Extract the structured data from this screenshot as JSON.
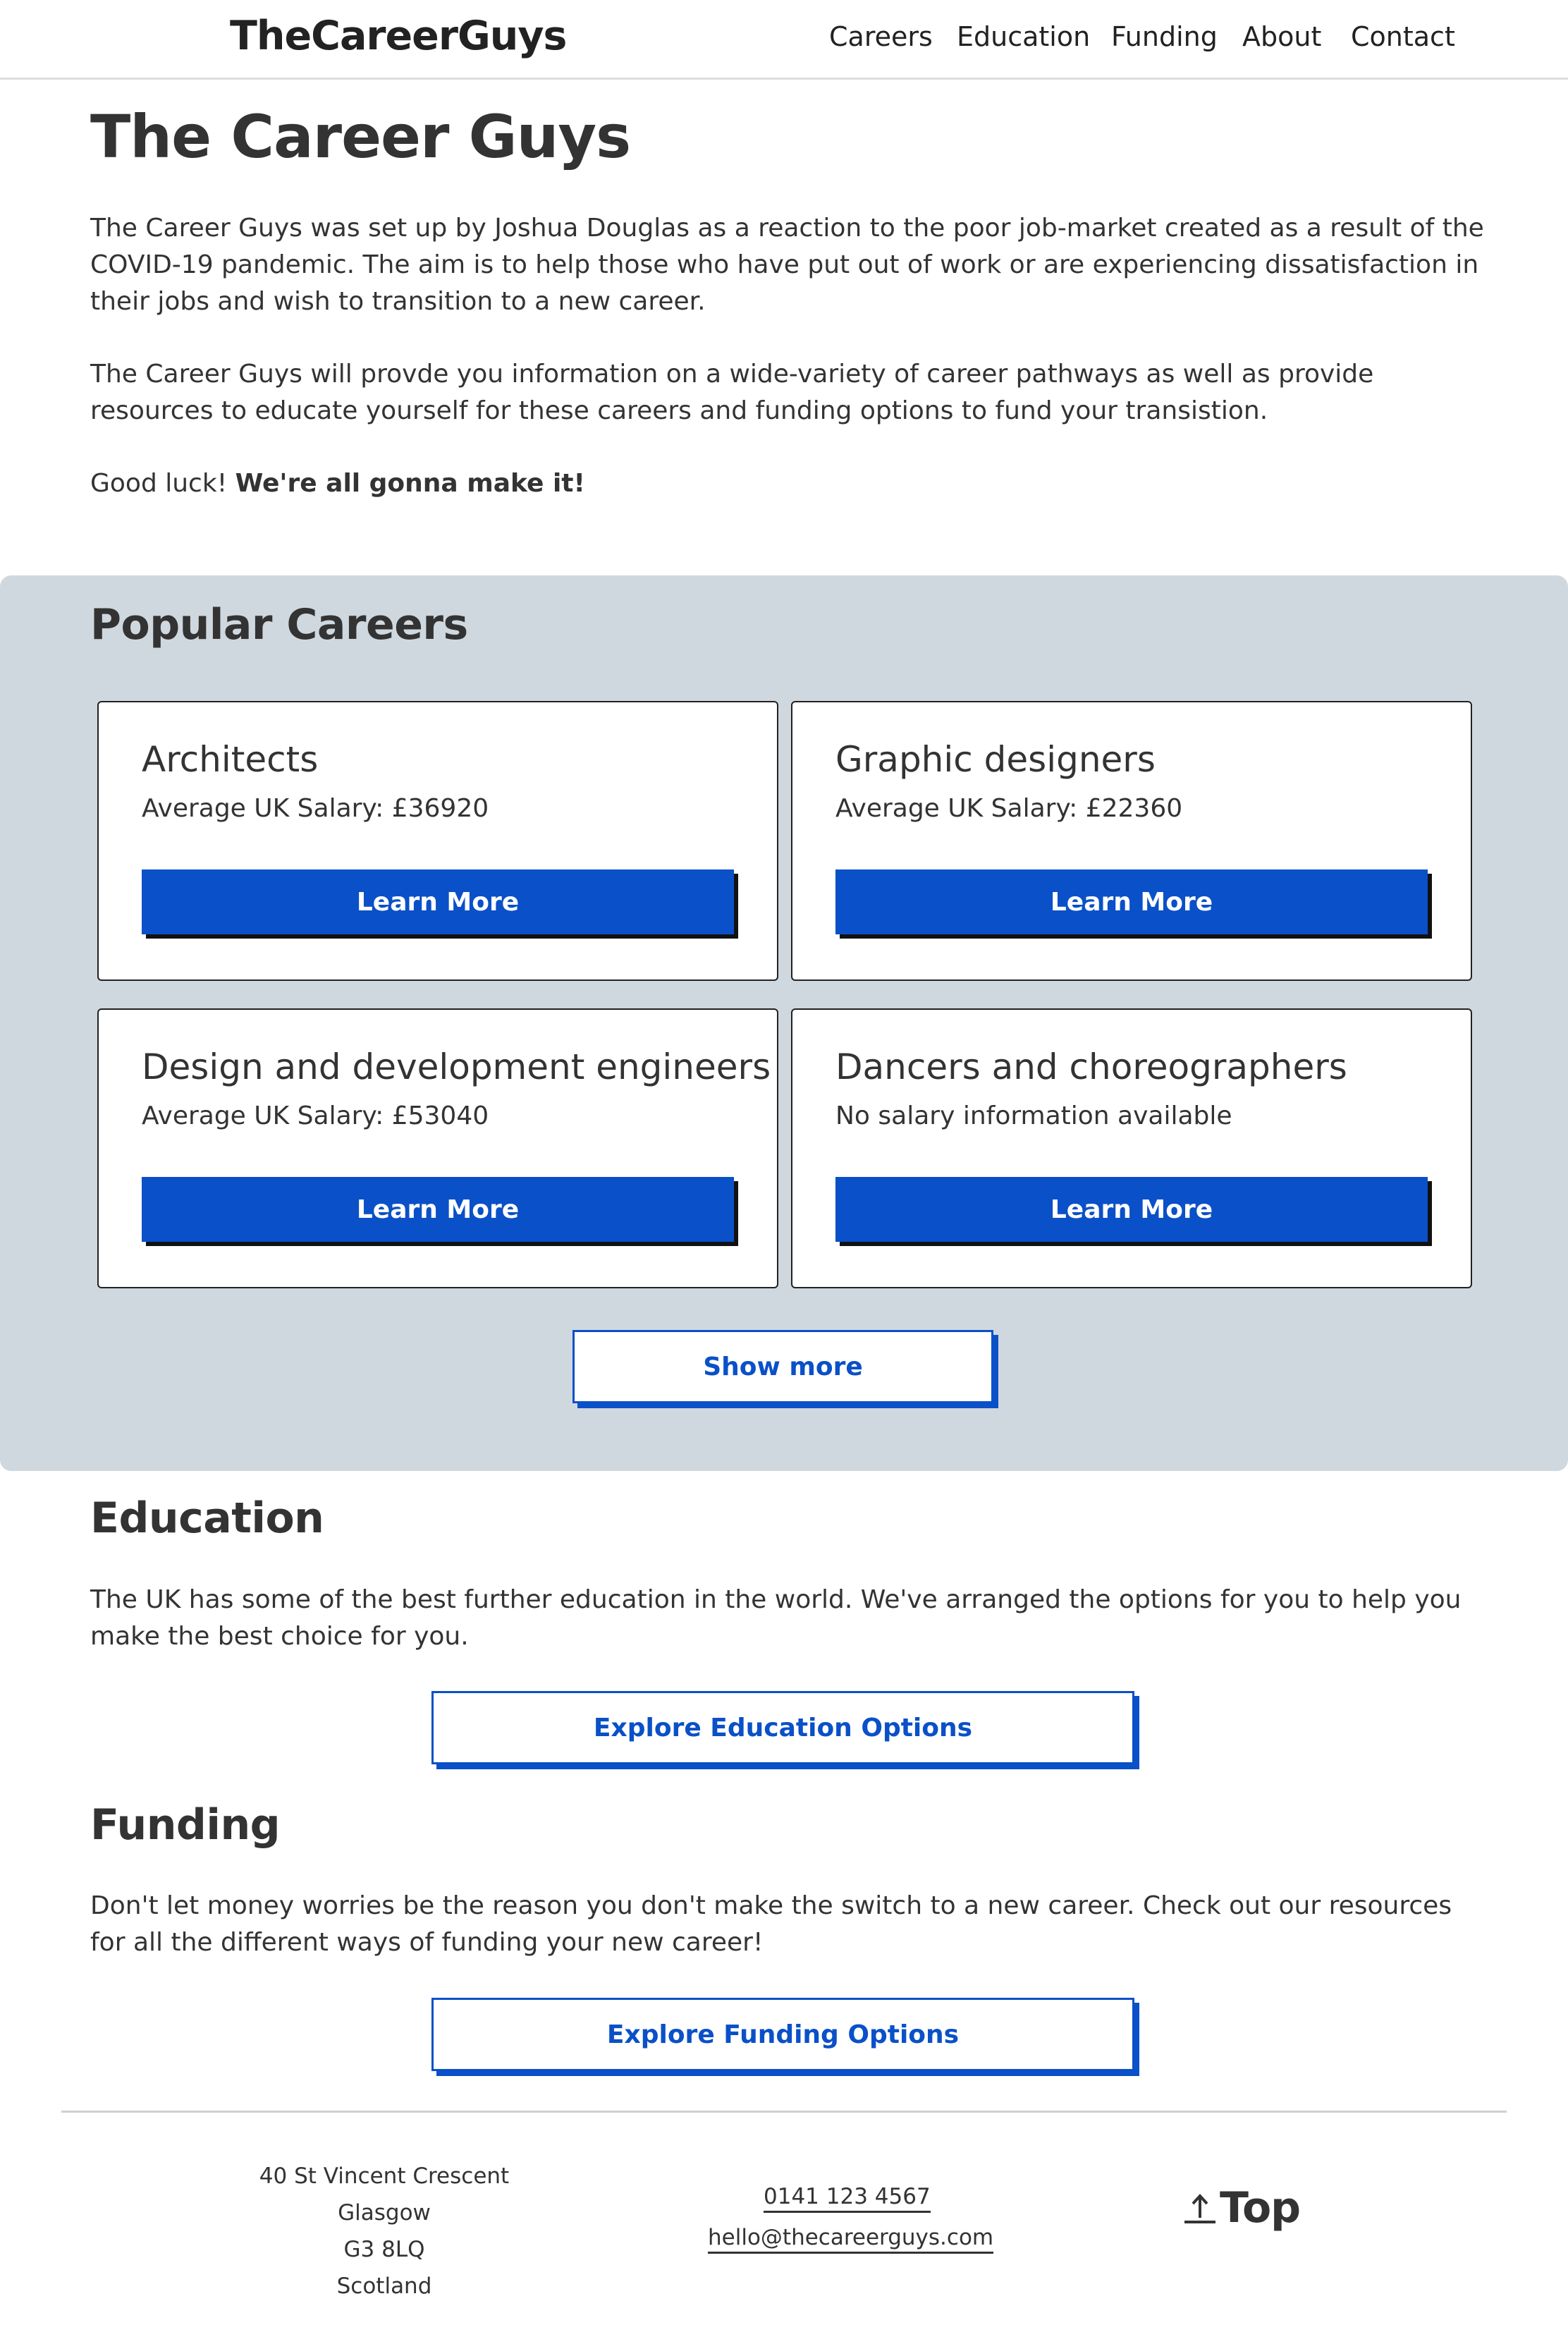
{
  "header": {
    "logo": "TheCareerGuys",
    "nav": [
      "Careers",
      "Education",
      "Funding",
      "About",
      "Contact"
    ]
  },
  "intro": {
    "title": "The Career Guys",
    "p1": "The Career Guys was set up by Joshua Douglas as a reaction to the poor job-market created as a result of the COVID-19 pandemic. The aim is to help those who have put out of work or are experiencing dissatisfaction in their jobs and wish to transition to a new career.",
    "p2": "The Career Guys will provde you information on a wide-variety of career pathways as well as provide resources to educate yourself for these careers and funding options to fund your transistion.",
    "p3_plain": "Good luck! ",
    "p3_bold": "We're all gonna make it!"
  },
  "popular": {
    "title": "Popular Careers",
    "cards": [
      {
        "title": "Architects",
        "salary": "Average UK Salary: £36920",
        "button": "Learn More"
      },
      {
        "title": "Graphic designers",
        "salary": "Average UK Salary: £22360",
        "button": "Learn More"
      },
      {
        "title": "Design and development engineers",
        "salary": "Average UK Salary: £53040",
        "button": "Learn More"
      },
      {
        "title": "Dancers and choreographers",
        "salary": "No salary information available",
        "button": "Learn More"
      }
    ],
    "show_more": "Show more"
  },
  "education": {
    "title": "Education",
    "text": "The UK has some of the best further education in the world. We've arranged the options for you to help you make the best choice for you.",
    "button": "Explore Education Options"
  },
  "funding": {
    "title": "Funding",
    "text": "Don't let money worries be the reason you don't make the switch to a new career. Check out our resources for all the different ways of funding your new career!",
    "button": "Explore Funding Options"
  },
  "footer": {
    "address": [
      "40 St Vincent Crescent",
      "Glasgow",
      "G3 8LQ",
      "Scotland"
    ],
    "phone": "0141 123 4567",
    "email": "hello@thecareerguys.com",
    "top_label": "Top"
  },
  "colors": {
    "accent": "#0a50c8",
    "section_bg": "#d0d8df",
    "text": "#333333"
  }
}
